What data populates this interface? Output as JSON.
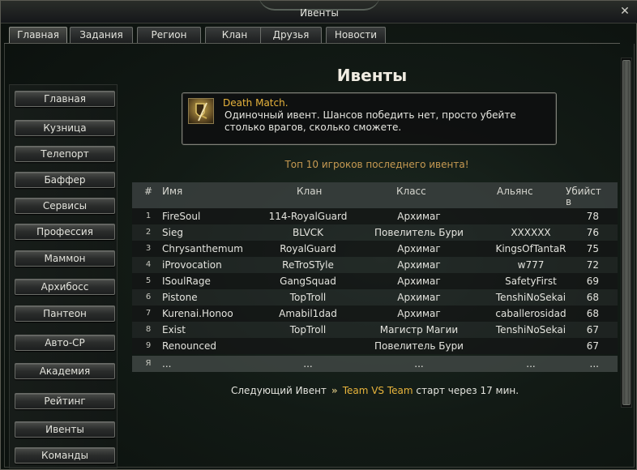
{
  "window": {
    "title": "Ивенты"
  },
  "tabs": [
    {
      "label": "Главная",
      "active": true
    },
    {
      "label": "Задания"
    },
    {
      "label": "Регион"
    },
    {
      "label": "Клан"
    },
    {
      "label": "Друзья"
    },
    {
      "label": "Новости"
    }
  ],
  "sidebar": {
    "items": [
      {
        "label": "Главная"
      },
      {
        "label": "Кузница"
      },
      {
        "label": "Телепорт"
      },
      {
        "label": "Баффер"
      },
      {
        "label": "Сервисы"
      },
      {
        "label": "Профессия"
      },
      {
        "label": "Маммон"
      },
      {
        "label": "Архибосс"
      },
      {
        "label": "Пантеон"
      },
      {
        "label": "Авто-CP"
      },
      {
        "label": "Академия"
      },
      {
        "label": "Рейтинг"
      },
      {
        "label": "Ивенты"
      },
      {
        "label": "Команды"
      }
    ]
  },
  "main": {
    "page_title": "Ивенты",
    "event": {
      "name": "Death Match.",
      "description": " Одиночный ивент. Шансов победить нет, просто убейте столько врагов, сколько сможете.",
      "icon": "sword-shield-icon"
    },
    "top10_caption": "Топ 10 игроков последнего ивента!",
    "table": {
      "headers": {
        "num": "#",
        "name": "Имя",
        "clan": "Клан",
        "class": "Класс",
        "ally": "Альянс",
        "kills": "Убийств"
      },
      "rows": [
        {
          "num": "1",
          "name": "FireSoul",
          "clan": "114-RoyalGuard",
          "class": "Архимаг",
          "ally": "",
          "kills": "78"
        },
        {
          "num": "2",
          "name": "Sieg",
          "clan": "BLVCK",
          "class": "Повелитель Бури",
          "ally": "XXXXXX",
          "kills": "76"
        },
        {
          "num": "3",
          "name": "Chrysanthemum",
          "clan": "RoyalGuard",
          "class": "Архимаг",
          "ally": "KingsOfTantaR",
          "kills": "75"
        },
        {
          "num": "4",
          "name": "iProvocation",
          "clan": "ReTroSTyle",
          "class": "Архимаг",
          "ally": "w777",
          "kills": "72"
        },
        {
          "num": "5",
          "name": "ISoulRage",
          "clan": "GangSquad",
          "class": "Архимаг",
          "ally": "SafetyFirst",
          "kills": "69"
        },
        {
          "num": "6",
          "name": "Pistone",
          "clan": "TopTroll",
          "class": "Архимаг",
          "ally": "TenshiNoSekai",
          "kills": "68"
        },
        {
          "num": "7",
          "name": "Kurenai.Honoo",
          "clan": "Amabil1dad",
          "class": "Архимаг",
          "ally": "caballerosidad",
          "kills": "68"
        },
        {
          "num": "8",
          "name": "Exist",
          "clan": "TopTroll",
          "class": "Магистр Магии",
          "ally": "TenshiNoSekai",
          "kills": "67"
        },
        {
          "num": "9",
          "name": "Renounced",
          "clan": "",
          "class": "Повелитель Бури",
          "ally": "",
          "kills": "67"
        },
        {
          "num": "Я",
          "name": "...",
          "clan": "...",
          "class": "...",
          "ally": "...",
          "kills": "..."
        }
      ]
    },
    "next_event": {
      "prefix": "Следующий Ивент",
      "name": "Team VS Team",
      "suffix": "старт через 17 мин."
    }
  }
}
